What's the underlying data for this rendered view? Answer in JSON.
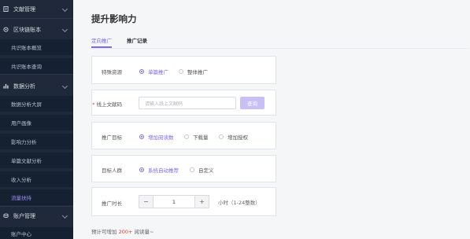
{
  "sidebar": {
    "sections": [
      {
        "label": "文献管理",
        "icon": "document-icon"
      },
      {
        "label": "区块链账本",
        "icon": "blockchain-icon"
      },
      {
        "label": "数据分析",
        "icon": "chart-bar-icon"
      },
      {
        "label": "账户管理",
        "icon": "account-icon"
      }
    ],
    "ledger_items": [
      "共识账本概览",
      "共识账本查询"
    ],
    "analysis_items": [
      "数据分析大屏",
      "用户画像",
      "影响力分析",
      "单篇文献分析",
      "收入分析",
      "流量扶持"
    ],
    "account_items": [
      "账户中心"
    ],
    "active_item": "流量扶持"
  },
  "page": {
    "title": "提升影响力",
    "tabs": [
      "定向推广",
      "推广记录"
    ],
    "active_tab": "定向推广"
  },
  "form": {
    "resource": {
      "label": "特殊资源",
      "options": [
        "单篇推广",
        "整体推广"
      ],
      "selected": "单篇推广"
    },
    "doc_code": {
      "label": "线上文献码",
      "placeholder": "请输入线上文献码",
      "button": "查询"
    },
    "goal": {
      "label": "推广目标",
      "options": [
        "增加阅读数",
        "下载量",
        "增加授权"
      ],
      "selected": "增加阅读数"
    },
    "audience": {
      "label": "目标人群",
      "options": [
        "系统自动推荐",
        "自定义"
      ],
      "selected": "系统自动推荐"
    },
    "duration": {
      "label": "推广时长",
      "value": "1",
      "minus": "−",
      "plus": "+",
      "unit": "小时（1-24整数）"
    }
  },
  "estimate": {
    "prefix": "预计可增加",
    "value": "200+",
    "suffix": "阅读量~"
  },
  "colors": {
    "accent": "#7b68ee",
    "sidebar_bg": "#1f2939",
    "highlight": "#e4393c"
  }
}
